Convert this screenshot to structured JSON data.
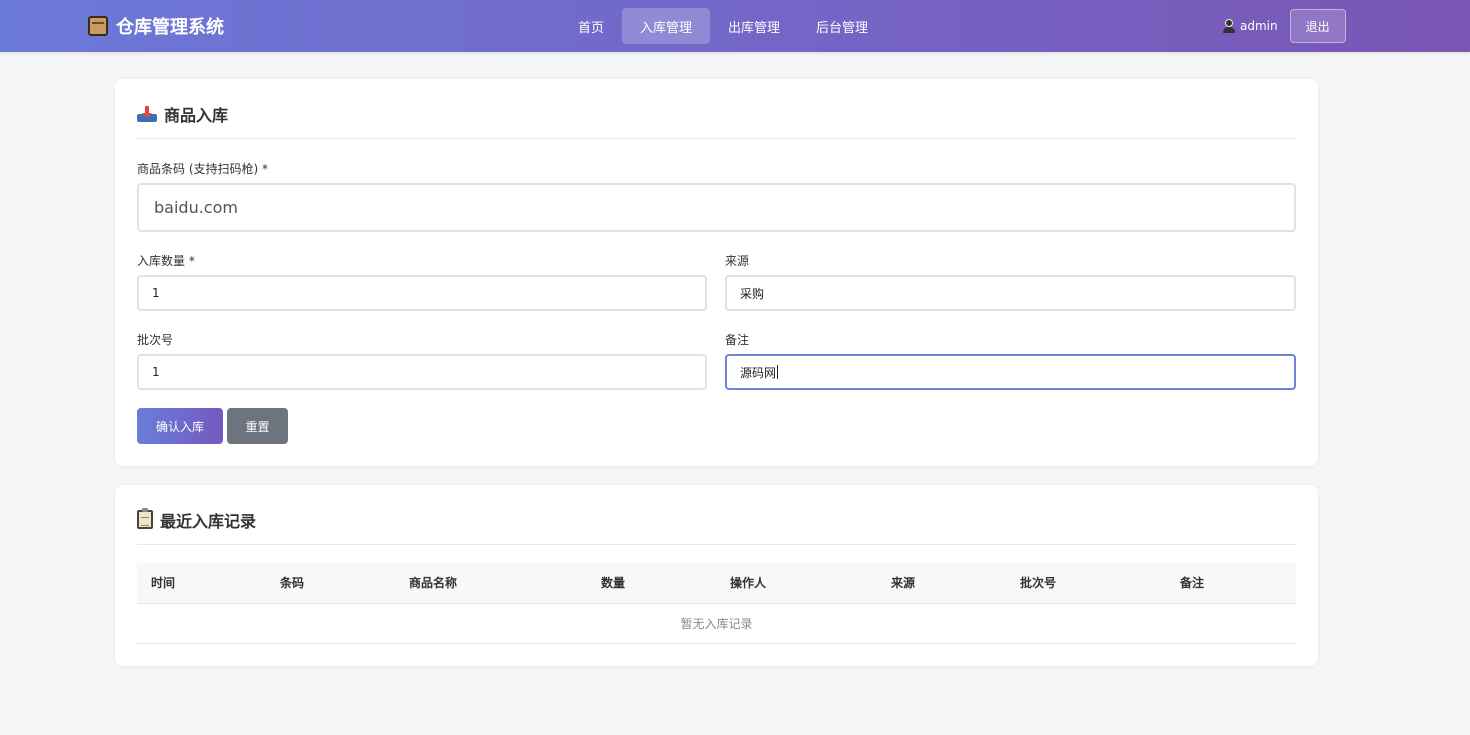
{
  "app": {
    "title": "仓库管理系统"
  },
  "nav": {
    "items": [
      {
        "label": "首页"
      },
      {
        "label": "入库管理"
      },
      {
        "label": "出库管理"
      },
      {
        "label": "后台管理"
      }
    ],
    "active_index": 1,
    "user": "admin",
    "logout_label": "退出"
  },
  "stock_in_form": {
    "title": "商品入库",
    "barcode": {
      "label": "商品条码 (支持扫码枪) *",
      "value": "baidu.com"
    },
    "quantity": {
      "label": "入库数量 *",
      "value": "1"
    },
    "source": {
      "label": "来源",
      "value": "采购"
    },
    "batch": {
      "label": "批次号",
      "value": "1"
    },
    "remark": {
      "label": "备注",
      "value": "源码网"
    },
    "confirm_label": "确认入库",
    "reset_label": "重置"
  },
  "recent_records": {
    "title": "最近入库记录",
    "columns": [
      "时间",
      "条码",
      "商品名称",
      "数量",
      "操作人",
      "来源",
      "批次号",
      "备注"
    ],
    "rows": [],
    "empty_text": "暂无入库记录"
  },
  "colors": {
    "nav_gradient_start": "#6b79d8",
    "nav_gradient_end": "#7a56b4",
    "primary_button": "#7069cc",
    "secondary_button": "#6c757d",
    "focus_border": "#7183d8",
    "page_background": "#f5f6f8"
  }
}
